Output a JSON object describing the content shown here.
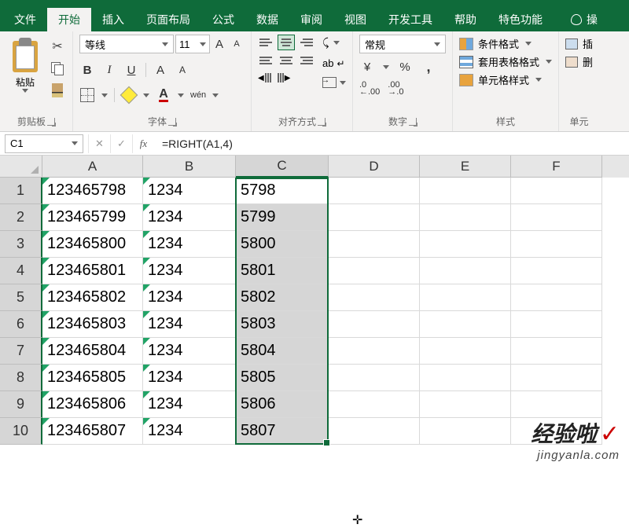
{
  "tabs": {
    "items": [
      "文件",
      "开始",
      "插入",
      "页面布局",
      "公式",
      "数据",
      "审阅",
      "视图",
      "开发工具",
      "帮助",
      "特色功能"
    ],
    "tell": "操"
  },
  "ribbon": {
    "clipboard": {
      "paste": "粘贴",
      "label": "剪贴板"
    },
    "font": {
      "name": "等线",
      "size": "11",
      "grow": "A",
      "shrink": "A",
      "bold": "B",
      "italic": "I",
      "underline": "U",
      "phonetic": "wén",
      "colorA": "A",
      "label": "字体"
    },
    "align": {
      "label": "对齐方式"
    },
    "number": {
      "format": "常规",
      "currency": "¥",
      "label": "数字"
    },
    "styles": {
      "cond": "条件格式",
      "table": "套用表格格式",
      "cell": "单元格样式",
      "label": "样式"
    },
    "cells": {
      "insert": "插",
      "delete": "删",
      "label": "单元"
    }
  },
  "formula_bar": {
    "ref": "C1",
    "fx": "fx",
    "formula": "=RIGHT(A1,4)",
    "cancel": "✕",
    "confirm": "✓"
  },
  "columns": [
    "A",
    "B",
    "C",
    "D",
    "E",
    "F"
  ],
  "rows": [
    {
      "n": "1",
      "a": "123465798",
      "b": "1234",
      "c": "5798"
    },
    {
      "n": "2",
      "a": "123465799",
      "b": "1234",
      "c": "5799"
    },
    {
      "n": "3",
      "a": "123465800",
      "b": "1234",
      "c": "5800"
    },
    {
      "n": "4",
      "a": "123465801",
      "b": "1234",
      "c": "5801"
    },
    {
      "n": "5",
      "a": "123465802",
      "b": "1234",
      "c": "5802"
    },
    {
      "n": "6",
      "a": "123465803",
      "b": "1234",
      "c": "5803"
    },
    {
      "n": "7",
      "a": "123465804",
      "b": "1234",
      "c": "5804"
    },
    {
      "n": "8",
      "a": "123465805",
      "b": "1234",
      "c": "5805"
    },
    {
      "n": "9",
      "a": "123465806",
      "b": "1234",
      "c": "5806"
    },
    {
      "n": "10",
      "a": "123465807",
      "b": "1234",
      "c": "5807"
    }
  ],
  "watermark": {
    "main": "经验啦",
    "check": "✓",
    "sub": "jingyanla.com"
  }
}
